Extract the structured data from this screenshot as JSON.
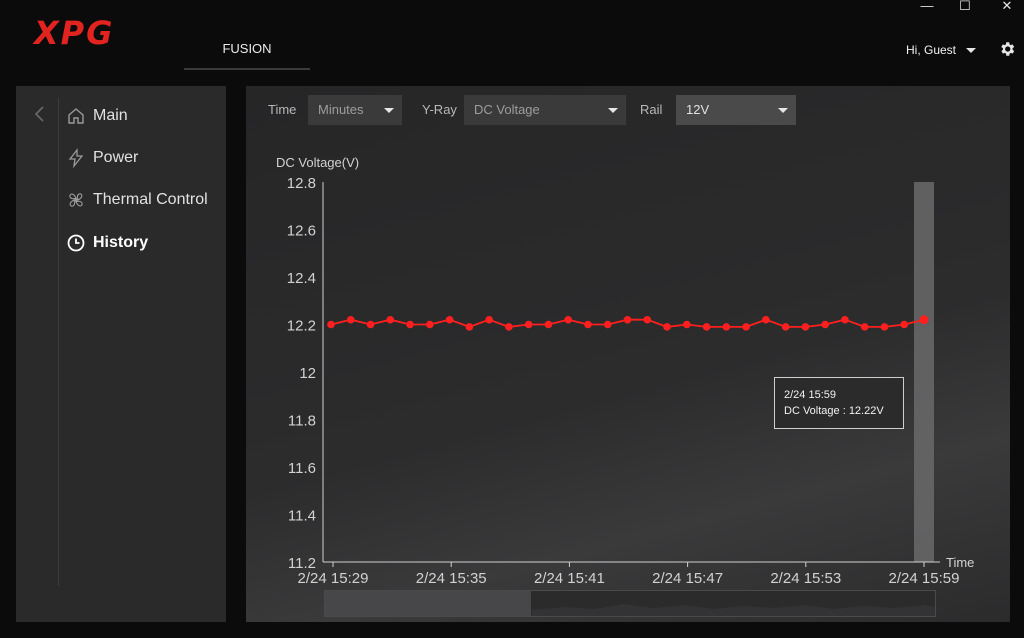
{
  "app": {
    "logo": "XPG",
    "tab": "FUSION",
    "greeting": "Hi, Guest",
    "window_controls": {
      "minimize": "—",
      "maximize": "☐",
      "close": "✕"
    }
  },
  "sidebar": {
    "items": [
      {
        "label": "Main",
        "icon": "home-icon"
      },
      {
        "label": "Power",
        "icon": "lightning-icon"
      },
      {
        "label": "Thermal Control",
        "icon": "fan-icon"
      },
      {
        "label": "History",
        "icon": "history-clock-icon",
        "active": true
      }
    ]
  },
  "filters": {
    "time_label": "Time",
    "time_value": "Minutes",
    "yray_label": "Y-Ray",
    "yray_value": "DC Voltage",
    "rail_label": "Rail",
    "rail_value": "12V"
  },
  "tooltip": {
    "time": "2/24 15:59",
    "text": "DC Voltage : 12.22V"
  },
  "colors": {
    "accent": "#e1241f",
    "series": "#ff1f1f"
  },
  "chart_data": {
    "type": "line",
    "ylabel": "DC Voltage(V)",
    "xlabel": "Time",
    "ylim": [
      11.2,
      12.8
    ],
    "yticks": [
      "11.2",
      "11.4",
      "11.6",
      "11.8",
      "12",
      "12.2",
      "12.4",
      "12.6",
      "12.8"
    ],
    "xticks": [
      "2/24 15:29",
      "2/24 15:35",
      "2/24 15:41",
      "2/24 15:47",
      "2/24 15:53",
      "2/24 15:59"
    ],
    "grid": false,
    "series": [
      {
        "values": [
          12.2,
          12.22,
          12.2,
          12.22,
          12.2,
          12.2,
          12.22,
          12.19,
          12.22,
          12.19,
          12.2,
          12.2,
          12.22,
          12.2,
          12.2,
          12.22,
          12.22,
          12.19,
          12.2,
          12.19,
          12.19,
          12.19,
          12.22,
          12.19,
          12.19,
          12.2,
          12.22,
          12.19,
          12.19,
          12.2,
          12.22
        ]
      }
    ],
    "highlighted_index": 30
  }
}
